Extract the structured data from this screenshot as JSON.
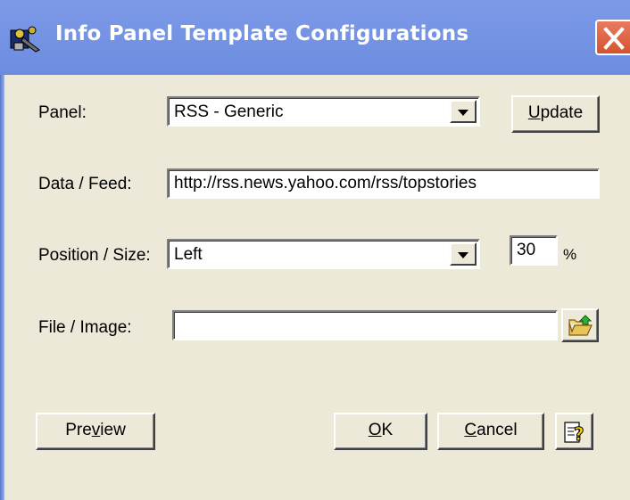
{
  "window": {
    "title": "Info Panel Template Configurations",
    "app_icon": "app-icon",
    "close_icon": "close-icon"
  },
  "panel": {
    "label": "Panel:",
    "selected": "RSS - Generic",
    "update_button": {
      "pre": "",
      "accel": "U",
      "post": "pdate"
    }
  },
  "feed": {
    "label": "Data / Feed:",
    "value": "http://rss.news.yahoo.com/rss/topstories"
  },
  "position": {
    "label": "Position / Size:",
    "selected": "Left",
    "size_value": "30",
    "size_unit": "%"
  },
  "file": {
    "label": "File / Image:",
    "value": "",
    "browse_icon": "folder-open-icon"
  },
  "buttons": {
    "preview": {
      "pre": "Pre",
      "accel": "v",
      "post": "iew"
    },
    "ok": {
      "pre": "",
      "accel": "O",
      "post": "K"
    },
    "cancel": {
      "pre": "",
      "accel": "C",
      "post": "ancel"
    },
    "help_icon": "help-icon"
  },
  "colors": {
    "titlebar": "#7d9ae8",
    "dialog_bg": "#ece9d8",
    "close_red": "#d5532f"
  }
}
